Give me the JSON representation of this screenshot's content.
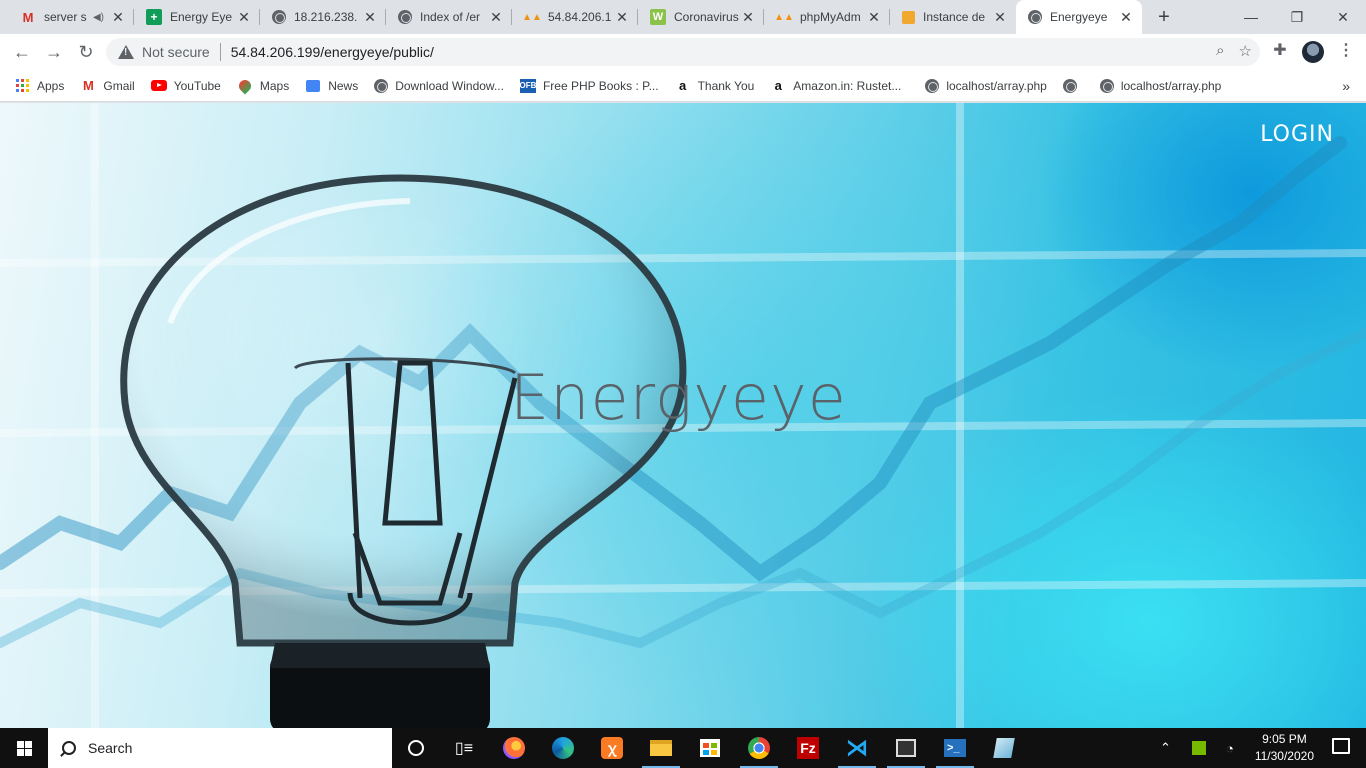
{
  "browser": {
    "tabs": [
      {
        "title": "server s",
        "icon": "gmail-icon",
        "muted": true
      },
      {
        "title": "Energy Eye",
        "icon": "sheets-icon"
      },
      {
        "title": "18.216.238.",
        "icon": "globe-icon"
      },
      {
        "title": "Index of /er",
        "icon": "globe-icon"
      },
      {
        "title": "54.84.206.1",
        "icon": "phpmyadmin-icon"
      },
      {
        "title": "Coronavirus",
        "icon": "coronavirus-icon"
      },
      {
        "title": "phpMyAdm",
        "icon": "phpmyadmin-icon"
      },
      {
        "title": "Instance de",
        "icon": "aws-icon"
      },
      {
        "title": "Energyeye",
        "icon": "globe-icon",
        "active": true
      }
    ],
    "security_label": "Not secure",
    "url": "54.84.206.199/energyeye/public/",
    "bookmarks": [
      {
        "label": "Apps",
        "icon": "apps-icon"
      },
      {
        "label": "Gmail",
        "icon": "gmail-icon"
      },
      {
        "label": "YouTube",
        "icon": "youtube-icon"
      },
      {
        "label": "Maps",
        "icon": "maps-icon"
      },
      {
        "label": "News",
        "icon": "news-icon"
      },
      {
        "label": "Download Window...",
        "icon": "globe-icon"
      },
      {
        "label": "Free PHP Books : P...",
        "icon": "ofb-icon"
      },
      {
        "label": "Thank You",
        "icon": "amazon-icon"
      },
      {
        "label": "Amazon.in: Rustet...",
        "icon": "amazon-icon"
      },
      {
        "label": "localhost/array.php",
        "icon": "globe-icon"
      },
      {
        "label": "",
        "icon": "globe-icon"
      },
      {
        "label": "localhost/array.php",
        "icon": "globe-icon"
      }
    ]
  },
  "page": {
    "login_label": "LOGIN",
    "hero_title": "Energyeye"
  },
  "taskbar": {
    "search_placeholder": "Search",
    "time": "9:05 PM",
    "date": "11/30/2020"
  },
  "colors": {
    "accent_cyan": "#22b6e1",
    "taskbar_bg": "#101010",
    "hero_text": "#5a6369"
  }
}
